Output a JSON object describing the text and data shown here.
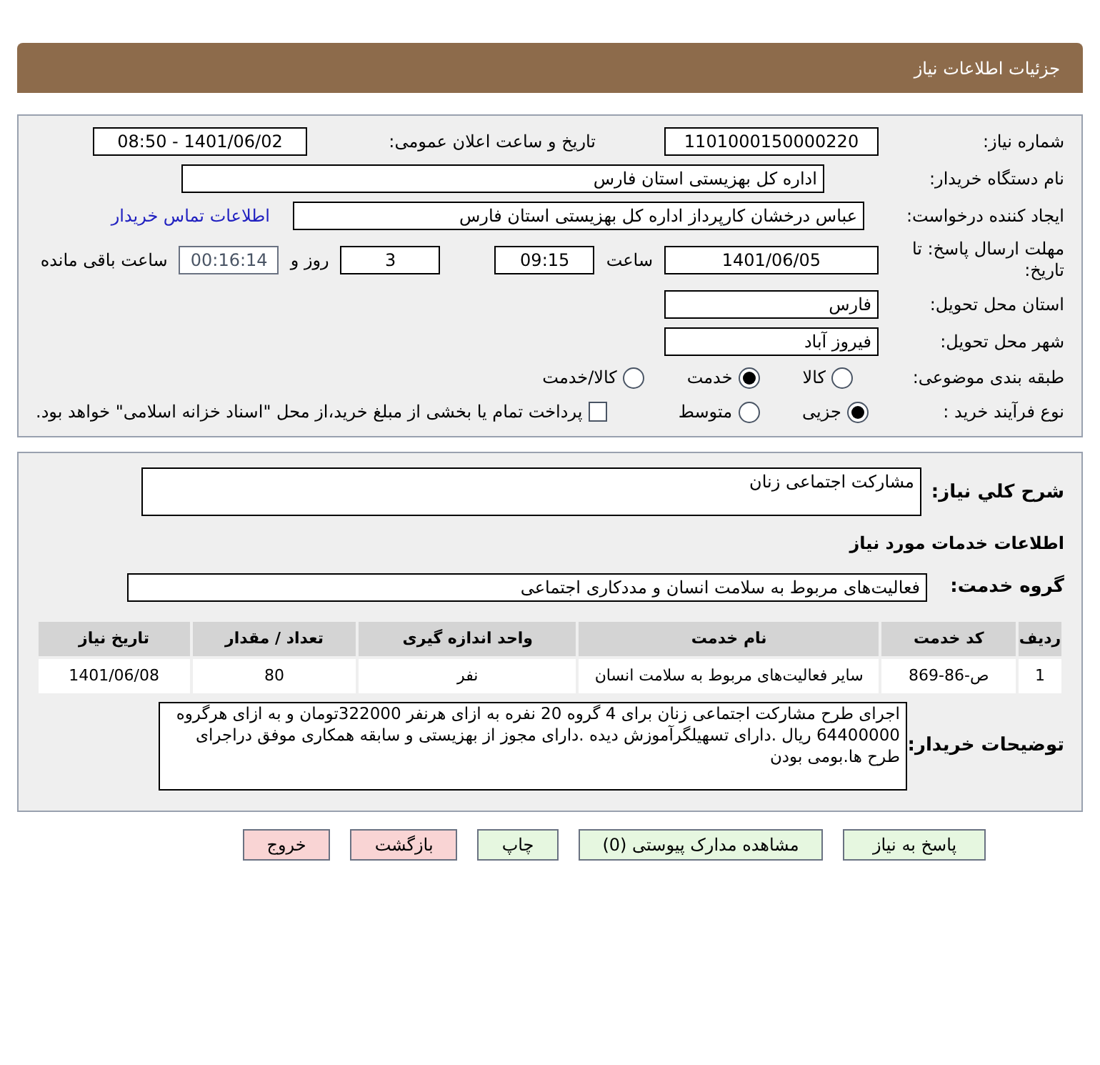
{
  "header": {
    "title": "جزئیات اطلاعات نیاز"
  },
  "need_number": {
    "label": "شماره نیاز:",
    "value": "1101000150000220"
  },
  "announce": {
    "label": "تاریخ و ساعت اعلان عمومی:",
    "value": "1401/06/02 - 08:50"
  },
  "buyer": {
    "label": "نام دستگاه خریدار:",
    "value": "اداره کل بهزیستی استان فارس"
  },
  "creator": {
    "label": "ایجاد کننده درخواست:",
    "value": "عباس درخشان کارپرداز اداره کل بهزیستی استان فارس",
    "link": "اطلاعات تماس خریدار"
  },
  "deadline": {
    "label": "مهلت ارسال پاسخ: تا تاریخ:",
    "date": "1401/06/05",
    "time_label": "ساعت",
    "time": "09:15",
    "days": "3",
    "days_label": "روز و",
    "remaining": "00:16:14",
    "remaining_label": "ساعت باقی مانده"
  },
  "province": {
    "label": "استان محل تحویل:",
    "value": "فارس"
  },
  "city": {
    "label": "شهر محل تحویل:",
    "value": "فیروز آباد"
  },
  "category": {
    "label": "طبقه بندی موضوعی:",
    "options": [
      {
        "label": "کالا",
        "selected": false
      },
      {
        "label": "خدمت",
        "selected": true
      },
      {
        "label": "کالا/خدمت",
        "selected": false
      }
    ]
  },
  "process": {
    "label": "نوع فرآیند خرید :",
    "options": [
      {
        "label": "جزیی",
        "selected": true
      },
      {
        "label": "متوسط",
        "selected": false
      }
    ],
    "treasury": {
      "label": "پرداخت تمام یا بخشی از مبلغ خرید،از محل \"اسناد خزانه اسلامی\" خواهد بود.",
      "checked": false
    }
  },
  "summary": {
    "label": "شرح کلي نیاز:",
    "value": "مشارکت اجتماعی زنان"
  },
  "services_heading": "اطلاعات خدمات مورد نیاز",
  "service_group": {
    "label": "گروه خدمت:",
    "value": "فعالیت‌های مربوط به سلامت انسان و مددکاری اجتماعی"
  },
  "table": {
    "columns": [
      "ردیف",
      "کد خدمت",
      "نام خدمت",
      "واحد اندازه گیری",
      "تعداد / مقدار",
      "تاریخ نیاز"
    ],
    "rows": [
      [
        "1",
        "ص-86-869",
        "سایر فعالیت‌های مربوط به سلامت انسان",
        "نفر",
        "80",
        "1401/06/08"
      ]
    ]
  },
  "notes": {
    "label": "توضیحات خریدار:",
    "value": "اجرای طرح مشارکت اجتماعی زنان برای 4 گروه 20 نفره  به ازای هرنفر 322000تومان  و به ازای هرگروه 64400000 ریال .دارای تسهیلگرآموزش دیده .دارای مجوز از بهزیستی و سابقه همکاری موفق دراجرای طرح ها.بومی بودن"
  },
  "buttons": [
    {
      "label": "پاسخ به نیاز",
      "kind": "normal"
    },
    {
      "label": "مشاهده مدارک پیوستی (0)",
      "kind": "normal"
    },
    {
      "label": "چاپ",
      "kind": "normal"
    },
    {
      "label": "بازگشت",
      "kind": "danger"
    },
    {
      "label": "خروج",
      "kind": "danger"
    }
  ]
}
